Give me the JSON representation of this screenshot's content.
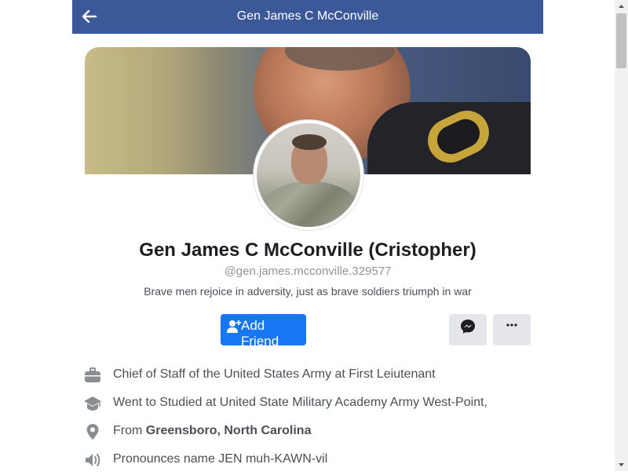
{
  "header": {
    "title": "Gen James C McConville",
    "back_icon": "arrow-left-icon"
  },
  "profile": {
    "name": "Gen James C McConville (Cristopher)",
    "username": "@gen.james.mcconville.329577",
    "bio": "Brave men rejoice in adversity, just as brave soldiers triumph in war"
  },
  "actions": {
    "add_friend_label": "Add Friend",
    "add_friend_icon": "add-person-icon",
    "messenger_icon": "messenger-icon",
    "more_icon": "more-dots-icon"
  },
  "info": {
    "work": {
      "icon": "briefcase-icon",
      "text": "Chief of Staff of the United States Army at First Leiutenant"
    },
    "education": {
      "icon": "graduation-cap-icon",
      "text": "Went to Studied at United State Military Academy Army West-Point,"
    },
    "location": {
      "icon": "location-pin-icon",
      "prefix": "From ",
      "value": "Greensboro, North Carolina"
    },
    "pronunciation": {
      "icon": "speaker-icon",
      "text": "Pronounces name JEN muh-KAWN-vil"
    }
  },
  "colors": {
    "header_bg": "#3b5998",
    "primary_button": "#1877f2",
    "secondary_button": "#e4e6eb",
    "text_primary": "#1c1e21",
    "text_secondary": "#4b4f56",
    "text_muted": "#90949c"
  }
}
